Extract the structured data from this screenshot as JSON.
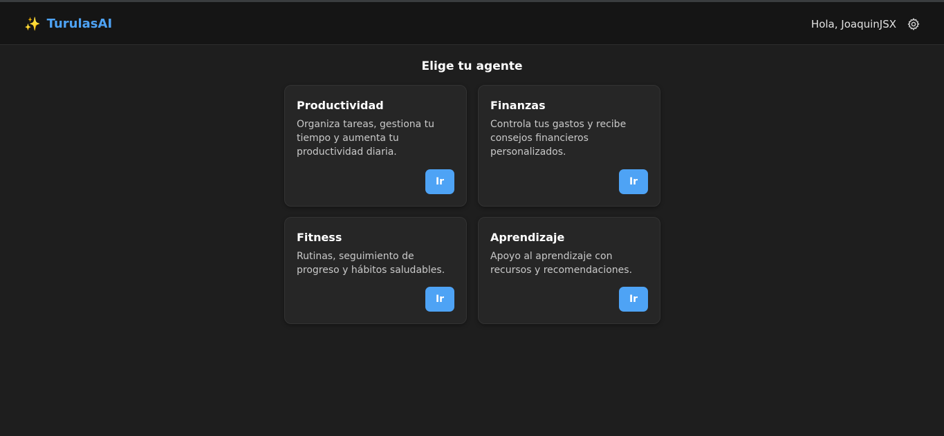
{
  "header": {
    "brand_icon": "sparkles-icon",
    "brand_icon_glyph": "✨",
    "brand_name": "TurulasAI",
    "greeting": "Hola, JoaquinJSX",
    "settings_icon": "gear-icon"
  },
  "main": {
    "title": "Elige tu agente",
    "agents": [
      {
        "title": "Productividad",
        "description": "Organiza tareas, gestiona tu tiempo y aumenta tu productividad diaria.",
        "button_label": "Ir"
      },
      {
        "title": "Finanzas",
        "description": "Controla tus gastos y recibe consejos financieros personalizados.",
        "button_label": "Ir"
      },
      {
        "title": "Fitness",
        "description": "Rutinas, seguimiento de progreso y hábitos saludables.",
        "button_label": "Ir"
      },
      {
        "title": "Aprendizaje",
        "description": "Apoyo al aprendizaje con recursos y recomendaciones.",
        "button_label": "Ir"
      }
    ]
  },
  "colors": {
    "background": "#1e1e1e",
    "header_background": "#151515",
    "card_background": "#262626",
    "accent": "#4ea3f5"
  }
}
